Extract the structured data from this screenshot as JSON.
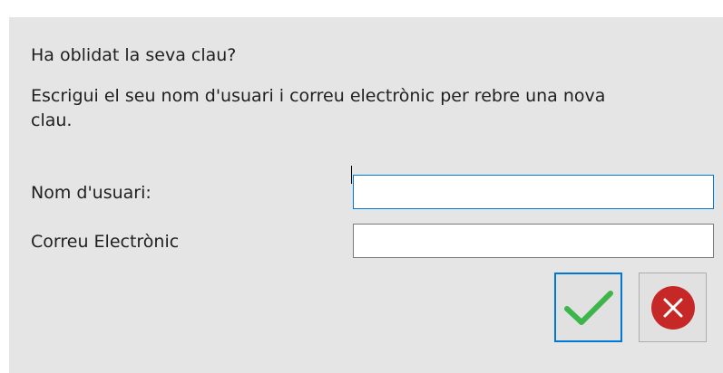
{
  "dialog": {
    "title": "Ha oblidat la seva clau?",
    "instructions": "Escrigui el seu nom d'usuari i correu electrònic per rebre una nova clau.",
    "fields": {
      "username_label": "Nom d'usuari:",
      "username_value": "",
      "email_label": "Correu Electrònic",
      "email_value": ""
    },
    "buttons": {
      "ok_icon": "checkmark-icon",
      "cancel_icon": "close-circle-icon"
    }
  },
  "colors": {
    "dialog_background": "#e5e5e5",
    "focus_border": "#0078d7",
    "check_green": "#3cb54a",
    "cancel_red": "#c62828"
  }
}
